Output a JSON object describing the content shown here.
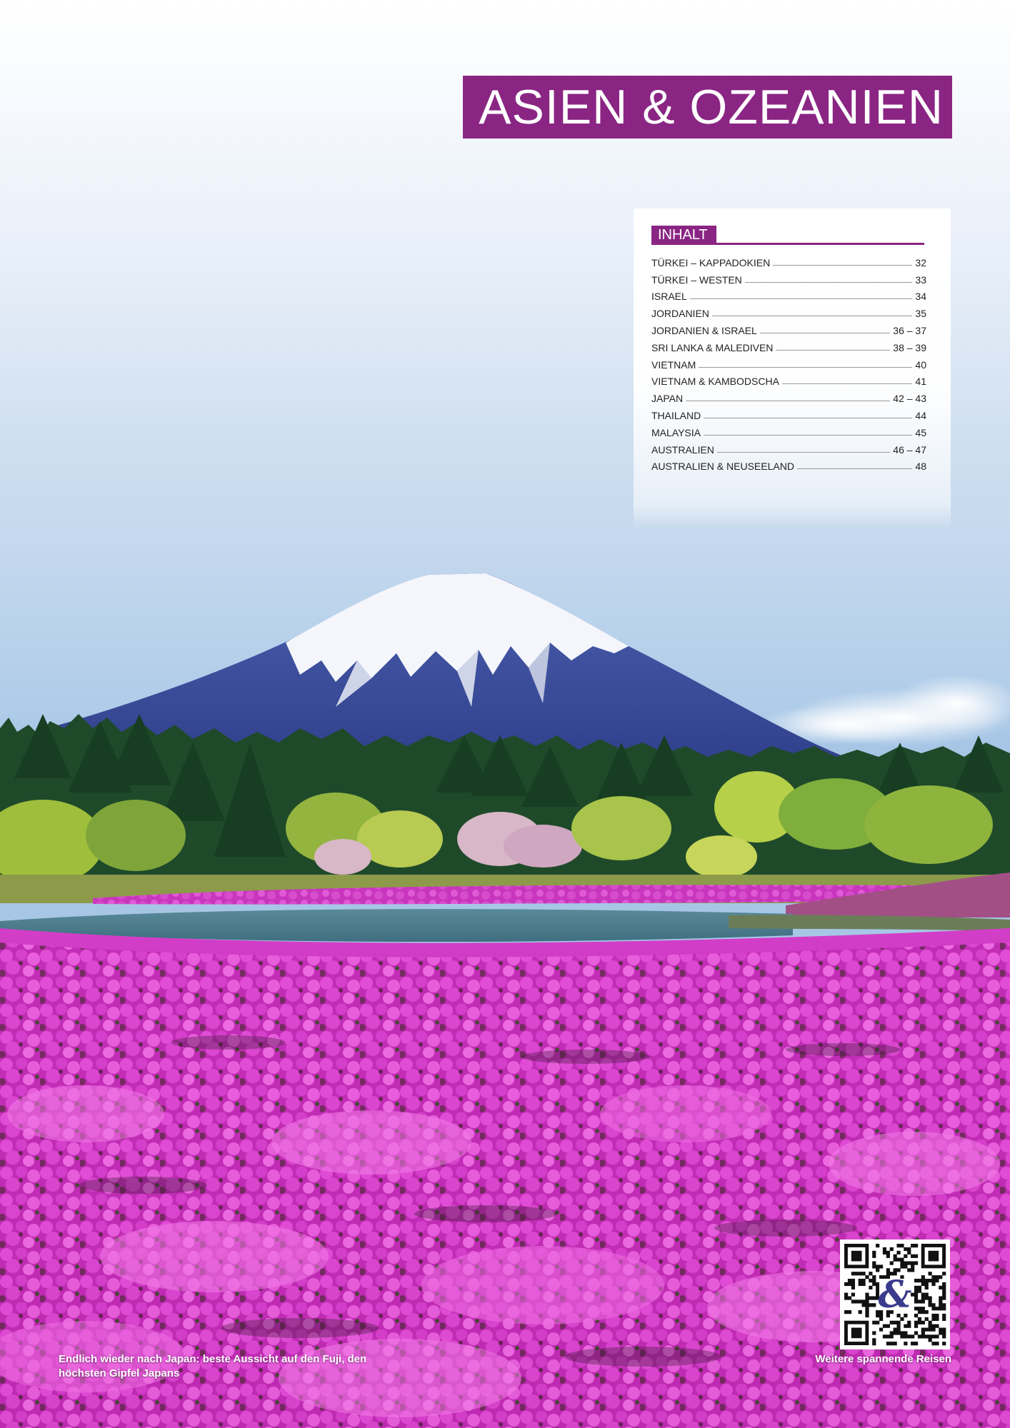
{
  "header": {
    "title": "ASIEN & OZEANIEN",
    "accent_color": "#8a2583"
  },
  "toc": {
    "heading": "INHALT",
    "entries": [
      {
        "label": "TÜRKEI – KAPPADOKIEN",
        "page": "32"
      },
      {
        "label": "TÜRKEI – WESTEN",
        "page": "33"
      },
      {
        "label": "ISRAEL",
        "page": "34"
      },
      {
        "label": "JORDANIEN",
        "page": "35"
      },
      {
        "label": "JORDANIEN & ISRAEL",
        "page": "36 – 37"
      },
      {
        "label": "SRI LANKA & MALEDIVEN",
        "page": "38 – 39"
      },
      {
        "label": "VIETNAM",
        "page": "40"
      },
      {
        "label": "VIETNAM & KAMBODSCHA",
        "page": "41"
      },
      {
        "label": "JAPAN",
        "page": "42 – 43"
      },
      {
        "label": "THAILAND",
        "page": "44"
      },
      {
        "label": "MALAYSIA",
        "page": "45"
      },
      {
        "label": "AUSTRALIEN",
        "page": "46 – 47"
      },
      {
        "label": "AUSTRALIEN & NEUSEELAND",
        "page": "48"
      }
    ]
  },
  "photo": {
    "caption": "Endlich wieder nach Japan: beste Aussicht auf den Fuji, den höchsten Gipfel Japans"
  },
  "qr": {
    "icon": "qr-code-icon",
    "center_glyph": "&",
    "link_label": "Weitere spannende Reisen"
  }
}
